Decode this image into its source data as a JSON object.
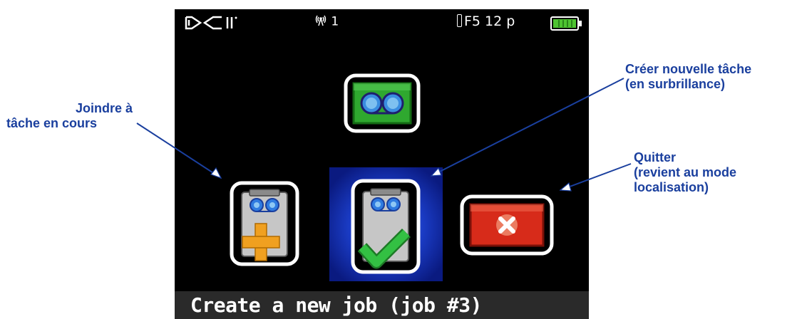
{
  "device": {
    "logo_text": "DCI",
    "signal_channel": "1",
    "frequency": "F5 12 p",
    "battery_level": 1.0,
    "icons": {
      "logo": "dci-logo",
      "signal": "antenna-icon",
      "frequency": "transmitter-icon",
      "battery": "battery-full-icon"
    }
  },
  "menu": {
    "top_icon": {
      "name": "job-mode-icon",
      "highlighted": false
    },
    "items": [
      {
        "id": "join",
        "icon": "join-job-icon",
        "badge": "plus",
        "highlighted": false
      },
      {
        "id": "create",
        "icon": "create-job-icon",
        "badge": "check",
        "highlighted": true
      },
      {
        "id": "exit",
        "icon": "exit-icon",
        "badge": "x",
        "highlighted": false
      }
    ],
    "caption": "Create a new job (job #3)"
  },
  "callouts": {
    "join": {
      "line1": "Joindre à",
      "line2": "tâche en cours"
    },
    "create": {
      "line1": "Créer nouvelle tâche",
      "line2": "(en surbrillance)"
    },
    "exit": {
      "line1": "Quitter",
      "line2": "(revient au mode",
      "line3": "localisation)"
    }
  },
  "colors": {
    "callout_text": "#1a3f9e",
    "highlight": "#0c1f9a",
    "job_icon_green": "#2fa82f",
    "exit_red": "#d72b1a",
    "plus_orange": "#f0a020",
    "check_green": "#2fb83a",
    "reel_blue": "#2f7be0"
  }
}
